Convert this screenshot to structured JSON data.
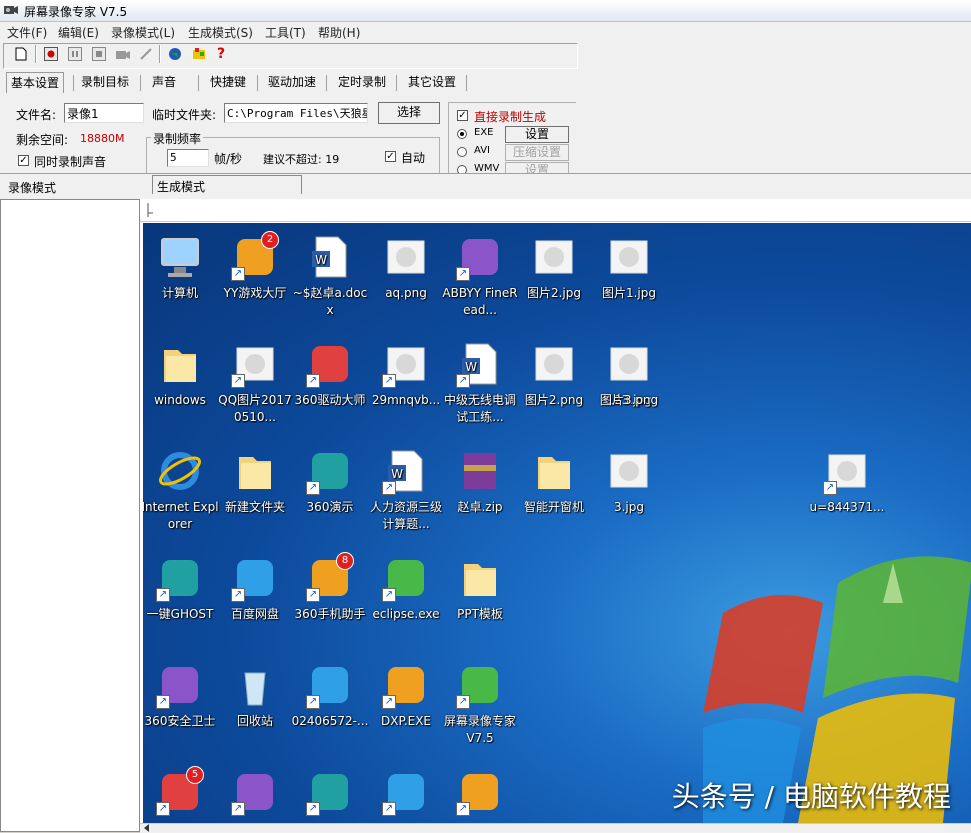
{
  "window": {
    "title": "屏幕录像专家 V7.5"
  },
  "menu": [
    "文件(F)",
    "编辑(E)",
    "录像模式(L)",
    "生成模式(S)",
    "工具(T)",
    "帮助(H)"
  ],
  "tabs": [
    "基本设置",
    "录制目标",
    "声音",
    "快捷键",
    "驱动加速",
    "定时录制",
    "其它设置"
  ],
  "basic": {
    "filename_label": "文件名:",
    "filename_value": "录像1",
    "tempdir_label": "临时文件夹:",
    "tempdir_value": "C:\\Program Files\\天狼星",
    "choose_button": "选择",
    "free_space_label": "剩余空间:",
    "free_space_value": "18880M",
    "record_audio_label": "同时录制声音",
    "freq_group_label": "录制频率",
    "fps_value": "5",
    "fps_unit": "帧/秒",
    "suggest_label": "建议不超过: 19",
    "auto_label": "自动"
  },
  "output": {
    "direct_label": "直接录制生成",
    "exe_label": "EXE",
    "avi_label": "AVI",
    "wmv_label": "WMV",
    "settings_button": "设置",
    "compress_button": "压缩设置",
    "wmv_settings_button": "设置"
  },
  "panes": {
    "left_header": "录像模式",
    "right_header": "生成模式"
  },
  "desktop_icons": [
    {
      "label": "计算机",
      "icon": "computer-icon"
    },
    {
      "label": "YY游戏大厅",
      "icon": "yy-game-icon",
      "badge": "2"
    },
    {
      "label": "~$赵卓a.docx",
      "icon": "word-doc-icon"
    },
    {
      "label": "aq.png",
      "icon": "image-icon"
    },
    {
      "label": "ABBYY FineRead...",
      "icon": "abbyy-icon"
    },
    {
      "label": "图片2.jpg",
      "icon": "image-icon"
    },
    {
      "label": "图片1.jpg",
      "icon": "image-icon"
    },
    {
      "label": "windows",
      "icon": "folder-icon"
    },
    {
      "label": "QQ图片20170510...",
      "icon": "image-icon"
    },
    {
      "label": "360驱动大师",
      "icon": "360-driver-icon"
    },
    {
      "label": "29mnqvb...",
      "icon": "image-icon"
    },
    {
      "label": "中级无线电调试工练...",
      "icon": "word-doc-icon"
    },
    {
      "label": "图片2.png",
      "icon": "image-icon"
    },
    {
      "label": "123.jpg",
      "icon": "image-icon"
    },
    {
      "label": "图片3.png",
      "icon": "image-icon"
    },
    {
      "label": "Internet Explorer",
      "icon": "ie-icon"
    },
    {
      "label": "新建文件夹",
      "icon": "folder-icon"
    },
    {
      "label": "360演示",
      "icon": "360-demo-icon"
    },
    {
      "label": "人力资源三级计算题...",
      "icon": "word-doc-icon"
    },
    {
      "label": "赵卓.zip",
      "icon": "winrar-icon"
    },
    {
      "label": "智能开窗机",
      "icon": "folder-icon"
    },
    {
      "label": "3.jpg",
      "icon": "image-icon"
    },
    {
      "label": "u=844371...",
      "icon": "image-icon"
    },
    {
      "label": "一键GHOST",
      "icon": "ghost-icon"
    },
    {
      "label": "百度网盘",
      "icon": "baidu-pan-icon"
    },
    {
      "label": "360手机助手",
      "icon": "360-phone-icon",
      "badge": "8"
    },
    {
      "label": "eclipse.exe",
      "icon": "eclipse-icon"
    },
    {
      "label": "PPT模板",
      "icon": "folder-icon"
    },
    {
      "label": "360安全卫士",
      "icon": "360-safe-icon"
    },
    {
      "label": "回收站",
      "icon": "recycle-bin-icon"
    },
    {
      "label": "02406572-...",
      "icon": "apk-icon"
    },
    {
      "label": "DXP.EXE",
      "icon": "dxp-icon"
    },
    {
      "label": "屏幕录像专家V7.5",
      "icon": "screen-recorder-icon"
    },
    {
      "label": "",
      "icon": "app-icon",
      "badge": "5"
    },
    {
      "label": "",
      "icon": "yy-icon"
    },
    {
      "label": "",
      "icon": "nox-icon"
    },
    {
      "label": "",
      "icon": "qq-icon"
    },
    {
      "label": "",
      "icon": "ppt-icon"
    }
  ],
  "watermark": "头条号 / 电脑软件教程",
  "colors": {
    "desktop_blue": "#1a6cc4",
    "red_text": "#c00000",
    "accent": "#0a5cc8"
  }
}
